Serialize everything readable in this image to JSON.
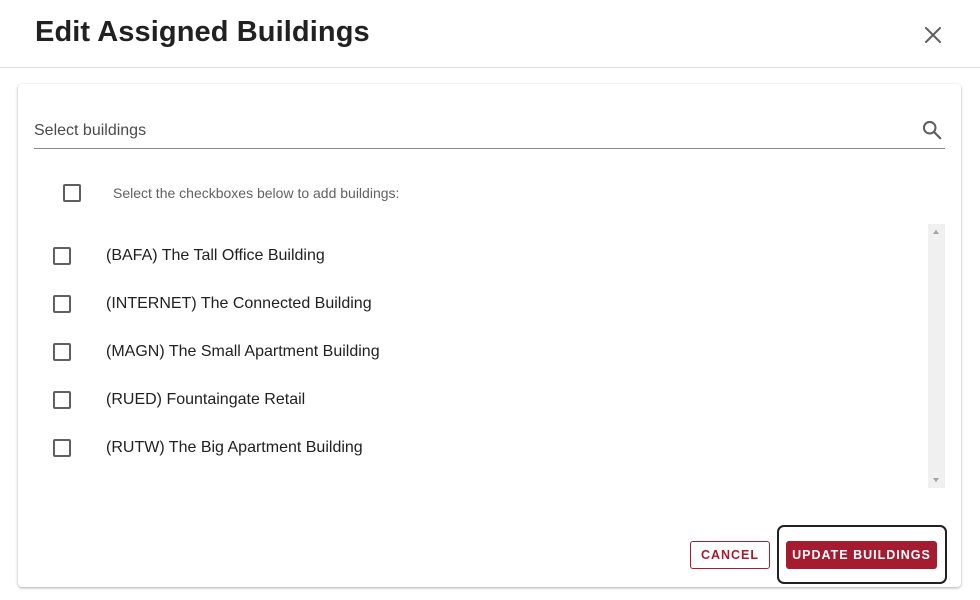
{
  "dialog": {
    "title": "Edit Assigned Buildings",
    "close_icon": "close-icon"
  },
  "search": {
    "placeholder": "Select buildings",
    "value": "",
    "icon": "search-icon"
  },
  "select_all": {
    "checked": false,
    "hint": "Select the checkboxes below to add buildings:"
  },
  "buildings": [
    {
      "label": "(BAFA) The Tall Office Building",
      "checked": false
    },
    {
      "label": "(INTERNET) The Connected Building",
      "checked": false
    },
    {
      "label": "(MAGN) The Small Apartment Building",
      "checked": false
    },
    {
      "label": "(RUED) Fountaingate Retail",
      "checked": false
    },
    {
      "label": "(RUTW) The Big Apartment Building",
      "checked": false
    }
  ],
  "actions": {
    "cancel_label": "CANCEL",
    "update_label": "UPDATE BUILDINGS"
  },
  "colors": {
    "accent": "#a51c30",
    "focus_ring": "#212121"
  }
}
